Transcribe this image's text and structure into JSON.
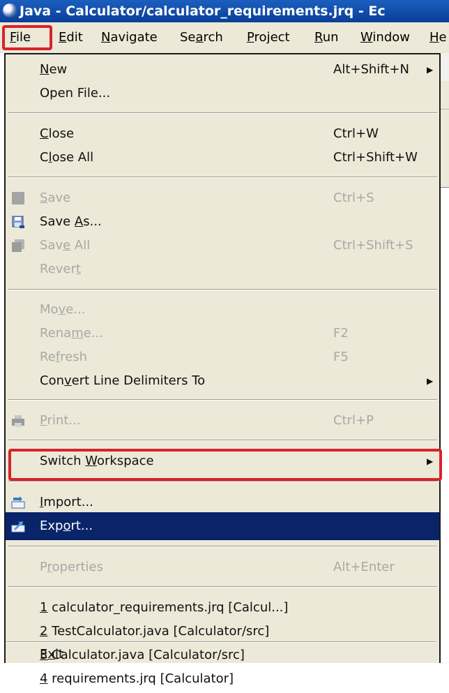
{
  "window": {
    "title": "Java - Calculator/calculator_requirements.jrq - Ec"
  },
  "menubar": [
    {
      "label": "File",
      "mnemonic": "F"
    },
    {
      "label": "Edit",
      "mnemonic": "E"
    },
    {
      "label": "Navigate",
      "mnemonic": "N"
    },
    {
      "label": "Search",
      "mnemonic": "a"
    },
    {
      "label": "Project",
      "mnemonic": "P"
    },
    {
      "label": "Run",
      "mnemonic": "R"
    },
    {
      "label": "Window",
      "mnemonic": "W"
    },
    {
      "label": "He",
      "mnemonic": "H"
    }
  ],
  "file_menu": {
    "new": {
      "label": "New",
      "accel": "Alt+Shift+N",
      "submenu": true
    },
    "open_file": {
      "label": "Open File..."
    },
    "close": {
      "label": "Close",
      "accel": "Ctrl+W"
    },
    "close_all": {
      "label": "Close All",
      "accel": "Ctrl+Shift+W"
    },
    "save": {
      "label": "Save",
      "accel": "Ctrl+S",
      "enabled": false
    },
    "save_as": {
      "label": "Save As..."
    },
    "save_all": {
      "label": "Save All",
      "accel": "Ctrl+Shift+S",
      "enabled": false
    },
    "revert": {
      "label": "Revert",
      "enabled": false
    },
    "move": {
      "label": "Move...",
      "enabled": false
    },
    "rename": {
      "label": "Rename...",
      "accel": "F2",
      "enabled": false
    },
    "refresh": {
      "label": "Refresh",
      "accel": "F5",
      "enabled": false
    },
    "convert": {
      "label": "Convert Line Delimiters To",
      "submenu": true
    },
    "print": {
      "label": "Print...",
      "accel": "Ctrl+P",
      "enabled": false
    },
    "switch_workspace": {
      "label": "Switch Workspace",
      "submenu": true
    },
    "import": {
      "label": "Import..."
    },
    "export": {
      "label": "Export...",
      "selected": true
    },
    "properties": {
      "label": "Properties",
      "accel": "Alt+Enter",
      "enabled": false
    },
    "recent": [
      {
        "num": "1",
        "text": " calculator_requirements.jrq  [Calcul...]"
      },
      {
        "num": "2",
        "text": " TestCalculator.java  [Calculator/src]"
      },
      {
        "num": "3",
        "text": " Calculator.java  [Calculator/src]"
      },
      {
        "num": "4",
        "text": " requirements.jrq  [Calculator]"
      }
    ],
    "exit": {
      "label": "Exit"
    }
  },
  "colors": {
    "menu_bg": "#ece9d8",
    "selection": "#0a246a",
    "highlight_box": "#d9222b",
    "title_bar": "#0a3f98"
  }
}
